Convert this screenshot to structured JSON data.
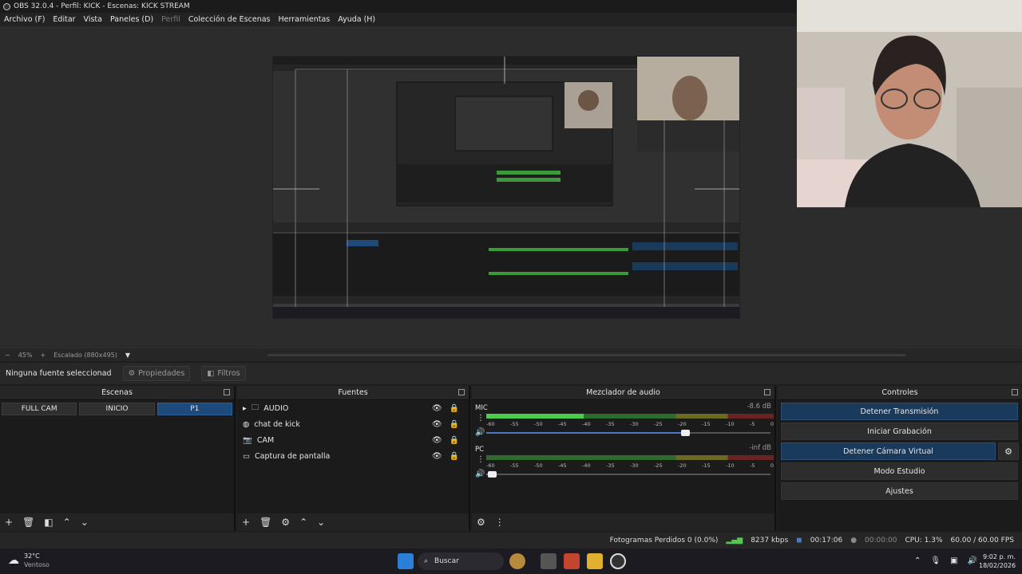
{
  "window": {
    "title": "OBS 32.0.4 - Perfil: KICK - Escenas: KICK STREAM"
  },
  "menu": [
    "Archivo (F)",
    "Editar",
    "Vista",
    "Paneles (D)",
    "Perfil",
    "Colección de Escenas",
    "Herramientas",
    "Ayuda (H)"
  ],
  "zoom": {
    "percent": "45%",
    "scale": "Escalado (880x495)"
  },
  "source_bar": {
    "none_selected": "Ninguna fuente seleccionad",
    "properties": "Propiedades",
    "filters": "Filtros"
  },
  "scenes": {
    "title": "Escenas",
    "items": [
      "FULL CAM",
      "INICIO",
      "P1"
    ],
    "active": "P1"
  },
  "sources": {
    "title": "Fuentes",
    "items": [
      {
        "name": "AUDIO",
        "icon": "folder-icon"
      },
      {
        "name": "chat de kick",
        "icon": "globe-icon"
      },
      {
        "name": "CAM",
        "icon": "camera-icon"
      },
      {
        "name": "Captura de pantalla",
        "icon": "monitor-icon"
      }
    ]
  },
  "mixer": {
    "title": "Mezclador de audio",
    "ticks": [
      "-60",
      "-55",
      "-50",
      "-45",
      "-40",
      "-35",
      "-30",
      "-25",
      "-20",
      "-15",
      "-10",
      "-5",
      "0"
    ],
    "channels": [
      {
        "name": "MIC",
        "db": "-8.6 dB",
        "level": 0.34,
        "volume": 0.7
      },
      {
        "name": "PC",
        "db": "-inf dB",
        "level": 0.0,
        "volume": 0.02
      }
    ]
  },
  "controls": {
    "title": "Controles",
    "stop_stream": "Detener Transmisión",
    "start_record": "Iniciar Grabación",
    "stop_vcam": "Detener Cámara Virtual",
    "studio_mode": "Modo Estudio",
    "settings": "Ajustes"
  },
  "status": {
    "dropped": "Fotogramas Perdidos 0 (0.0%)",
    "bitrate": "8237 kbps",
    "stream_time": "00:17:06",
    "rec_time": "00:00:00",
    "cpu": "CPU: 1.3%",
    "fps": "60.00 / 60.00 FPS"
  },
  "taskbar": {
    "weather_temp": "32°C",
    "weather_desc": "Ventoso",
    "search": "Buscar",
    "time": "9:02 p. m.",
    "date": "18/02/2026"
  },
  "colors": {
    "accent": "#1c4a7a",
    "meter_green": "#4ccc4c",
    "meter_yellow": "#6b6a22",
    "meter_red": "#6a2323"
  }
}
